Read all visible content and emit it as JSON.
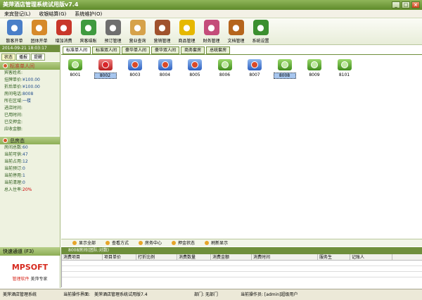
{
  "window": {
    "title": "美萍酒店管理系统试用版v7.4"
  },
  "menu": [
    "来宾登记(L)",
    "收银结算(G)",
    "系统维护(O)"
  ],
  "toolbar": [
    {
      "label": "散客开单",
      "icon": "guest-icon",
      "color": "#4a7fc8"
    },
    {
      "label": "团体开单",
      "icon": "group-icon",
      "color": "#d68a2a"
    },
    {
      "label": "增加消费",
      "icon": "add-consume-icon",
      "color": "#c8372a"
    },
    {
      "label": "宾客结账",
      "icon": "checkout-icon",
      "color": "#3f9a3f"
    },
    {
      "label": "预订管理",
      "icon": "clock-icon",
      "color": "#6f6f6f"
    },
    {
      "label": "营业查询",
      "icon": "query-icon",
      "color": "#d6a24a"
    },
    {
      "label": "营销管理",
      "icon": "marketing-icon",
      "color": "#a0522d"
    },
    {
      "label": "商品管理",
      "icon": "star-icon",
      "color": "#e6b800"
    },
    {
      "label": "财务管理",
      "icon": "finance-icon",
      "color": "#c44d7a"
    },
    {
      "label": "文档管理",
      "icon": "document-icon",
      "color": "#b5651d"
    },
    {
      "label": "系统设置",
      "icon": "settings-icon",
      "color": "#3b8f2f"
    }
  ],
  "left": {
    "date": "2014-09-21 18:03:17",
    "tabs": [
      "状态",
      "播报",
      "提醒"
    ],
    "room_section": "标准单人间",
    "room_info": [
      {
        "k": "宾客姓名:",
        "v": ""
      },
      {
        "k": "挂牌单价:",
        "v": "¥100.00"
      },
      {
        "k": "折后单价:",
        "v": "¥100.00"
      },
      {
        "k": "房间电话:",
        "v": "8008"
      },
      {
        "k": "所在区域:",
        "v": "一楼"
      },
      {
        "k": "进店时间:",
        "v": ""
      },
      {
        "k": "已用时间:",
        "v": ""
      },
      {
        "k": "已交押金:",
        "v": ""
      },
      {
        "k": "应收金额:",
        "v": ""
      }
    ],
    "status_section": "总房态",
    "status_info": [
      {
        "k": "房间总数:",
        "v": "60"
      },
      {
        "k": "当前可供:",
        "v": "47"
      },
      {
        "k": "当前占用:",
        "v": "12"
      },
      {
        "k": "当前预订:",
        "v": "0"
      },
      {
        "k": "当前停用:",
        "v": "1"
      },
      {
        "k": "当前清理:",
        "v": "0"
      },
      {
        "k": "总入住率:",
        "v": "20%"
      }
    ],
    "quick_channel": "快速通道 (F3)",
    "logo_brand": "MPSOFT",
    "logo_slogan_1": "管理软件",
    "logo_slogan_2": "美萍专家"
  },
  "room_tabs": [
    "标准单人间",
    "标准双人间",
    "豪华单人间",
    "豪华双人间",
    "商务套房",
    "总统套房"
  ],
  "rooms": [
    {
      "num": "8001",
      "state": "green",
      "selected": false
    },
    {
      "num": "8002",
      "state": "red",
      "selected": true
    },
    {
      "num": "8003",
      "state": "blue",
      "selected": false
    },
    {
      "num": "8004",
      "state": "blue",
      "selected": false
    },
    {
      "num": "8005",
      "state": "blue",
      "selected": false
    },
    {
      "num": "8006",
      "state": "green",
      "selected": false
    },
    {
      "num": "8007",
      "state": "blue",
      "selected": false
    },
    {
      "num": "8008",
      "state": "green",
      "selected": true
    },
    {
      "num": "8009",
      "state": "green",
      "selected": false
    },
    {
      "num": "8101",
      "state": "green",
      "selected": false
    }
  ],
  "actions": [
    "显示全部",
    "查看方式",
    "房务中心",
    "押金状态",
    "刷新显示"
  ],
  "detail": {
    "header": "8008房间(团队:对数)",
    "columns": [
      "消费项目",
      "项目单价",
      "打折比例",
      "消费数量",
      "消费金额",
      "消费时间",
      "服务生",
      "记账人"
    ]
  },
  "status": {
    "app": "美萍酒店管理系统",
    "current_label": "当前操作界面:",
    "current_value": "美萍酒店管理系统试用版7.4",
    "dept": "部门: 无部门",
    "operator": "当前操作员: [admin]超级用户"
  }
}
